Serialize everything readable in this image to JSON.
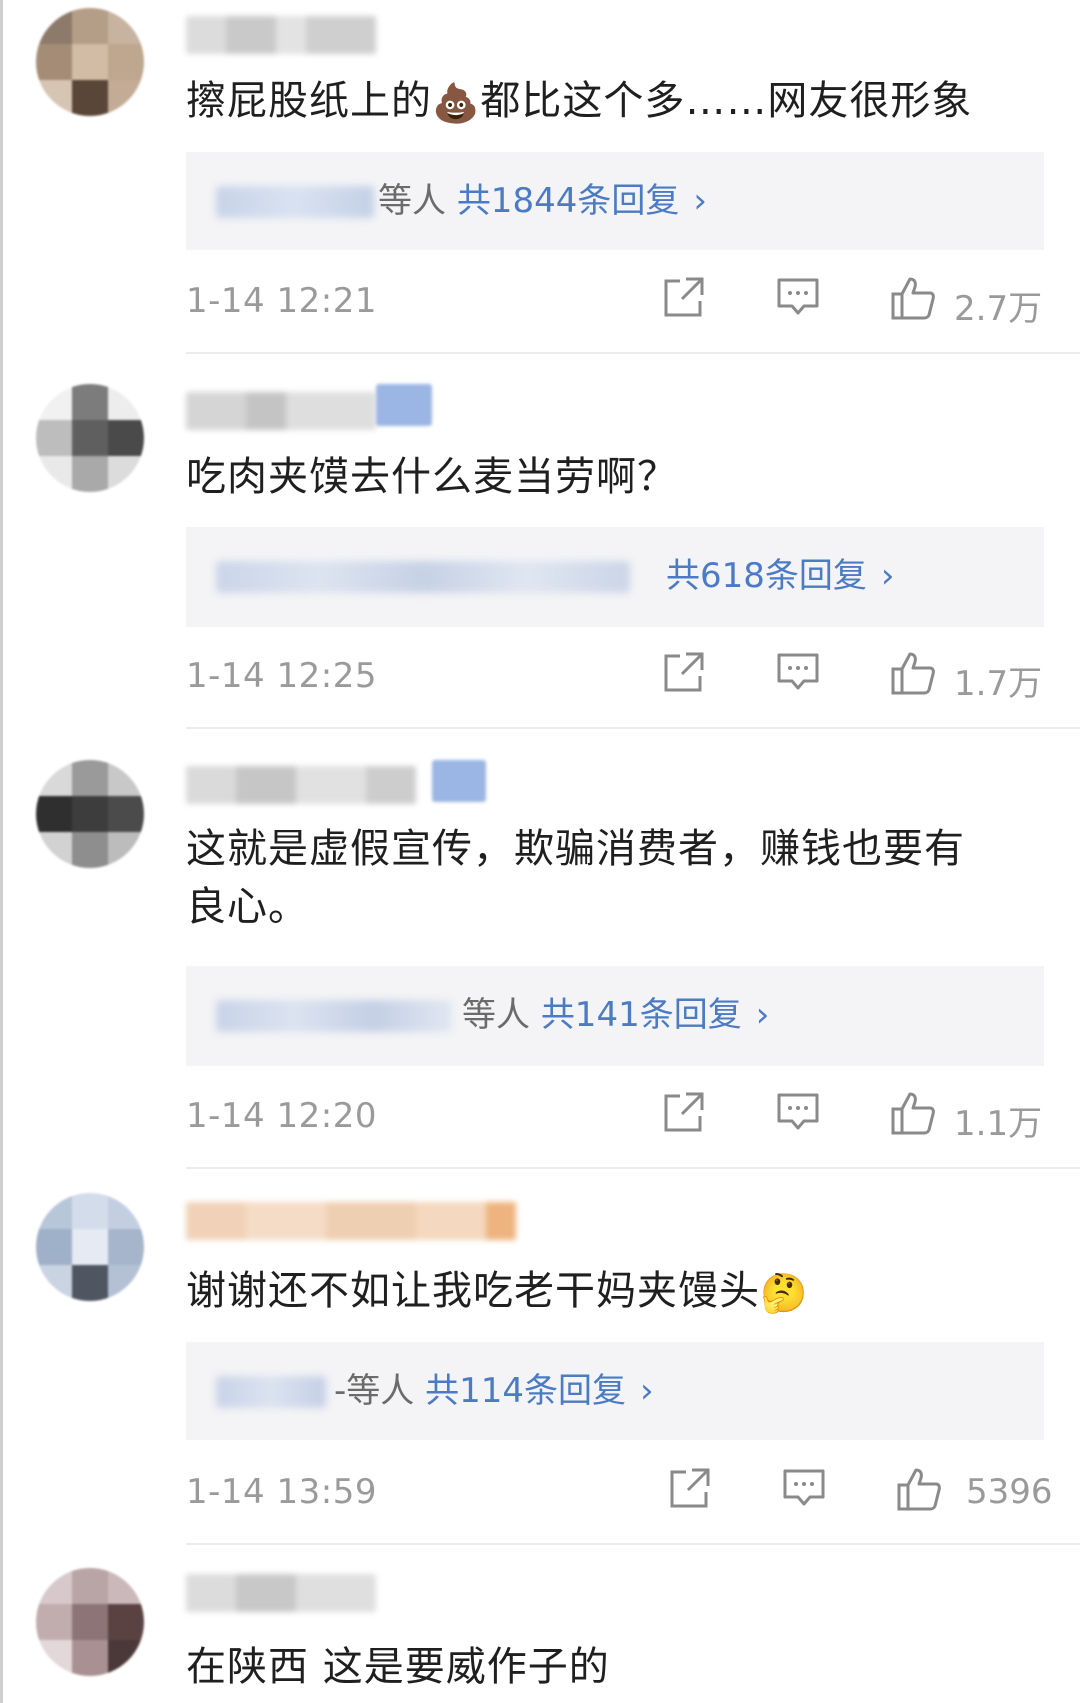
{
  "comments": [
    {
      "text": "擦屁股纸上的💩都比这个多……网友很形象",
      "text_before_emoji": "擦屁股纸上的",
      "emoji": "💩",
      "text_after_emoji": "都比这个多……网友很形象",
      "reply_suffix": "等人",
      "reply_count": "共1844条回复",
      "time": "1-14 12:21",
      "likes": "2.7万"
    },
    {
      "text": "吃肉夹馍去什么麦当劳啊？",
      "reply_suffix": "",
      "reply_count": "共618条回复",
      "time": "1-14 12:25",
      "likes": "1.7万"
    },
    {
      "text_line1": "这就是虚假宣传，欺骗消费者，赚钱也要有",
      "text_line2": "良心。",
      "reply_suffix": "等人",
      "reply_count": "共141条回复",
      "time": "1-14 12:20",
      "likes": "1.1万"
    },
    {
      "text_before_emoji": "谢谢还不如让我吃老干妈夹馒头",
      "emoji": "🤔",
      "reply_suffix": "-等人",
      "reply_count": "共114条回复",
      "time": "1-14 13:59",
      "likes": "5396"
    },
    {
      "text": "在陕西 这是要威作子的"
    }
  ],
  "icons": {
    "share": "share-icon",
    "comment": "comment-icon",
    "like": "like-icon",
    "chevron": "›"
  },
  "colors": {
    "link_blue": "#4a7bc4",
    "meta_gray": "#9a9a9a",
    "reply_bg": "#f4f4f6"
  }
}
